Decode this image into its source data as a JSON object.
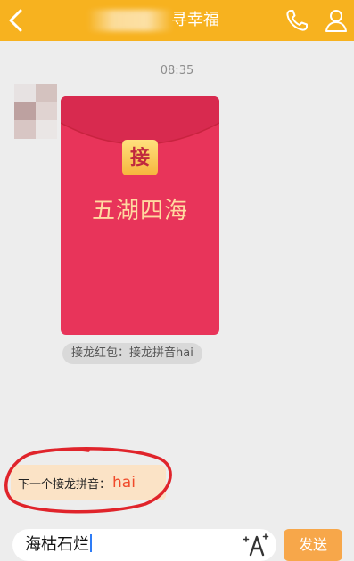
{
  "header": {
    "title": "寻幸福",
    "accent_color": "#f7b21f",
    "back_icon": "chevron-left-icon",
    "call_icon": "phone-icon",
    "profile_icon": "person-icon"
  },
  "chat": {
    "timestamp": "08:35",
    "red_packet": {
      "seal": "接",
      "word": "五湖四海",
      "color": "#e8345a"
    },
    "caption": "接龙红包：接龙拼音hai"
  },
  "hint": {
    "label": "下一个接龙拼音：",
    "value": "hai"
  },
  "composer": {
    "text": "海枯石烂",
    "font_icon": "font-style-icon",
    "send_label": "发送"
  }
}
